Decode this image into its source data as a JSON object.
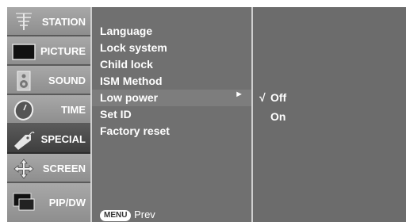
{
  "categories": [
    {
      "label": "STATION",
      "icon": "antenna-icon",
      "selected": false
    },
    {
      "label": "PICTURE",
      "icon": "tv-screen-icon",
      "selected": false
    },
    {
      "label": "SOUND",
      "icon": "speaker-icon",
      "selected": false
    },
    {
      "label": "TIME",
      "icon": "clock-icon",
      "selected": false
    },
    {
      "label": "SPECIAL",
      "icon": "tag-icon",
      "selected": true
    },
    {
      "label": "SCREEN",
      "icon": "move-arrows-icon",
      "selected": false
    },
    {
      "label": "PIP/DW",
      "icon": "pip-windows-icon",
      "selected": false
    }
  ],
  "menu_items": [
    "Language",
    "Lock system",
    "Child lock",
    "ISM Method",
    "Low power",
    "Set ID",
    "Factory reset"
  ],
  "selected_item": "Low power",
  "submenu": {
    "check_mark": "√",
    "options": [
      "Off",
      "On"
    ],
    "checked": "Off"
  },
  "footer": {
    "button_label": "MENU",
    "text": "Prev"
  },
  "colors": {
    "panel": "#6f6f6f",
    "selected_category": "#4a4a4a",
    "text": "#ffffff"
  }
}
